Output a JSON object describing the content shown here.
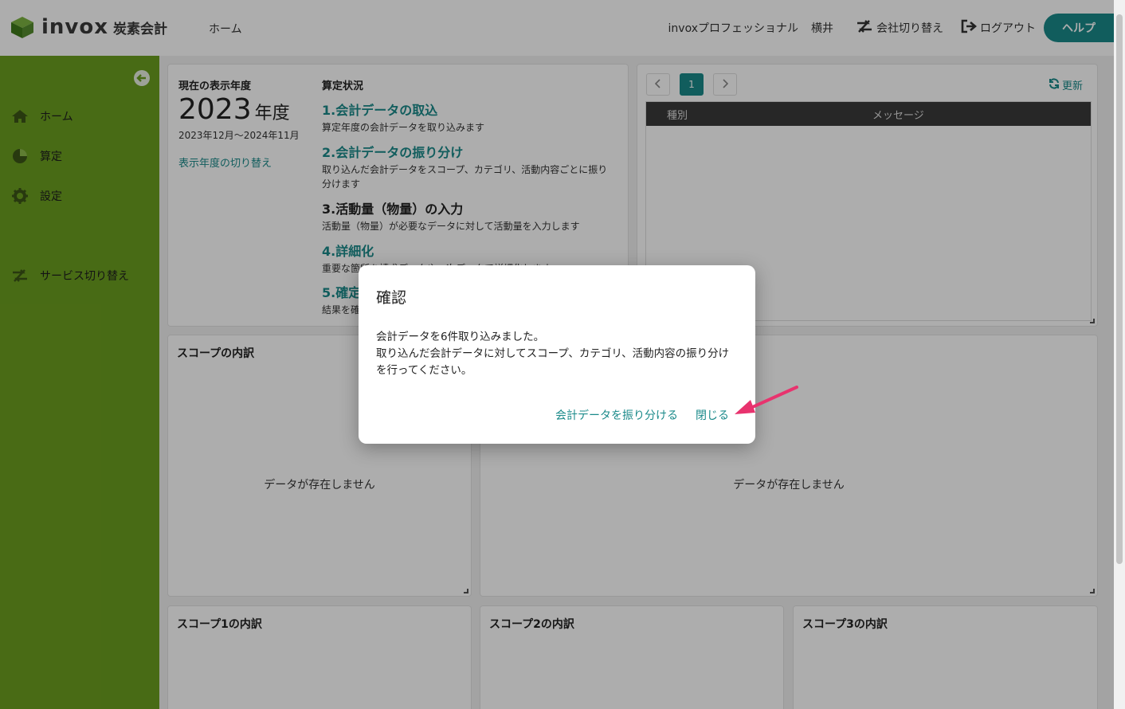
{
  "header": {
    "logo_text": "invox",
    "logo_sub": "炭素会計",
    "nav_home": "ホーム",
    "company": "invoxプロフェッショナル",
    "user": "横井",
    "switch_company": "会社切り替え",
    "logout": "ログアウト",
    "help": "ヘルプ"
  },
  "sidebar": {
    "items": [
      {
        "label": "ホーム",
        "icon": "home-icon"
      },
      {
        "label": "算定",
        "icon": "pie-chart-icon"
      },
      {
        "label": "設定",
        "icon": "gear-icon"
      },
      {
        "label": "サービス切り替え",
        "icon": "switch-icon"
      }
    ]
  },
  "year_panel": {
    "label": "現在の表示年度",
    "year": "2023",
    "year_unit": "年度",
    "range": "2023年12月〜2024年11月",
    "switch_link": "表示年度の切り替え"
  },
  "status_panel": {
    "label": "算定状況",
    "steps": [
      {
        "title": "1.会計データの取込",
        "desc": "算定年度の会計データを取り込みます"
      },
      {
        "title": "2.会計データの振り分け",
        "desc": "取り込んだ会計データをスコープ、カテゴリ、活動内容ごとに振り分けます"
      },
      {
        "title": "3.活動量（物量）の入力",
        "desc": "活動量（物量）が必要なデータに対して活動量を入力します"
      },
      {
        "title": "4.詳細化",
        "desc": "重要な箇所を請求データや一次データで詳細化します"
      },
      {
        "title": "5.確定",
        "desc": "結果を確"
      }
    ]
  },
  "messages": {
    "page": "1",
    "refresh": "更新",
    "columns": [
      "種別",
      "メッセージ"
    ]
  },
  "cards": {
    "scope_breakdown": "スコープの内訳",
    "empty": "データが存在しません",
    "scope1": "スコープ1の内訳",
    "scope2": "スコープ2の内訳",
    "scope3": "スコープ3の内訳"
  },
  "modal": {
    "title": "確認",
    "line1": "会計データを6件取り込みました。",
    "line2": "取り込んだ会計データに対してスコープ、カテゴリ、活動内容の振り分けを行ってください。",
    "assign_button": "会計データを振り分ける",
    "close_button": "閉じる"
  },
  "colors": {
    "accent": "#1a8a8a",
    "sidebar": "#6b9e1f",
    "annotation_arrow": "#e8336e"
  }
}
